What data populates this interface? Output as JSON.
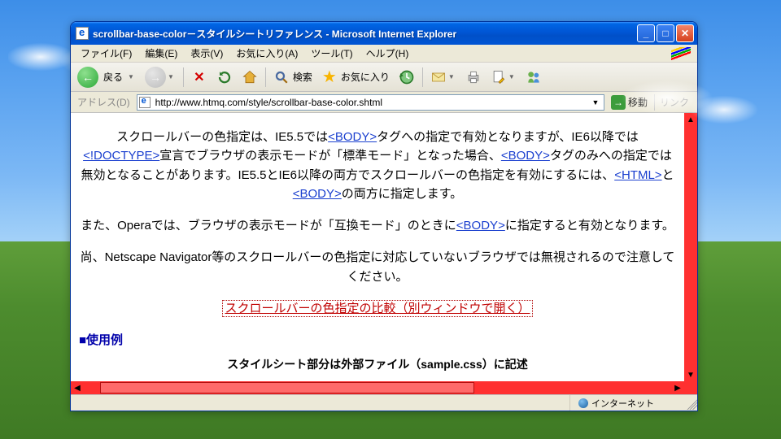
{
  "window": {
    "title": "scrollbar-base-color－スタイルシートリファレンス - Microsoft Internet Explorer"
  },
  "menu": {
    "file": "ファイル(F)",
    "edit": "編集(E)",
    "view": "表示(V)",
    "favorites": "お気に入り(A)",
    "tools": "ツール(T)",
    "help": "ヘルプ(H)"
  },
  "toolbar": {
    "back": "戻る",
    "search": "検索",
    "favorites": "お気に入り"
  },
  "address": {
    "label": "アドレス(D)",
    "url": "http://www.htmq.com/style/scrollbar-base-color.shtml",
    "go": "移動",
    "links": "リンク"
  },
  "page": {
    "p1_a": "スクロールバーの色指定は、IE5.5では",
    "p1_link1": "<BODY>",
    "p1_b": "タグへの指定で有効となりますが、IE6以降では",
    "p1_link2": "<!DOCTYPE>",
    "p1_c": "宣言でブラウザの表示モードが「標準モード」となった場合、",
    "p1_link3": "<BODY>",
    "p1_d": "タグのみへの指定では無効となることがあります。IE5.5とIE6以降の両方でスクロールバーの色指定を有効にするには、",
    "p1_link4": "<HTML>",
    "p1_e": "と",
    "p1_link5": "<BODY>",
    "p1_f": "の両方に指定します。",
    "p2_a": "また、Operaでは、ブラウザの表示モードが「互換モード」のときに",
    "p2_link1": "<BODY>",
    "p2_b": "に指定すると有効となります。",
    "p3": "尚、Netscape Navigator等のスクロールバーの色指定に対応していないブラウザでは無視されるので注意してください。",
    "compare_link": "スクロールバーの色指定の比較（別ウィンドウで開く）",
    "heading": "■使用例",
    "example_caption": "スタイルシート部分は外部ファイル（sample.css）に記述"
  },
  "status": {
    "zone": "インターネット"
  }
}
